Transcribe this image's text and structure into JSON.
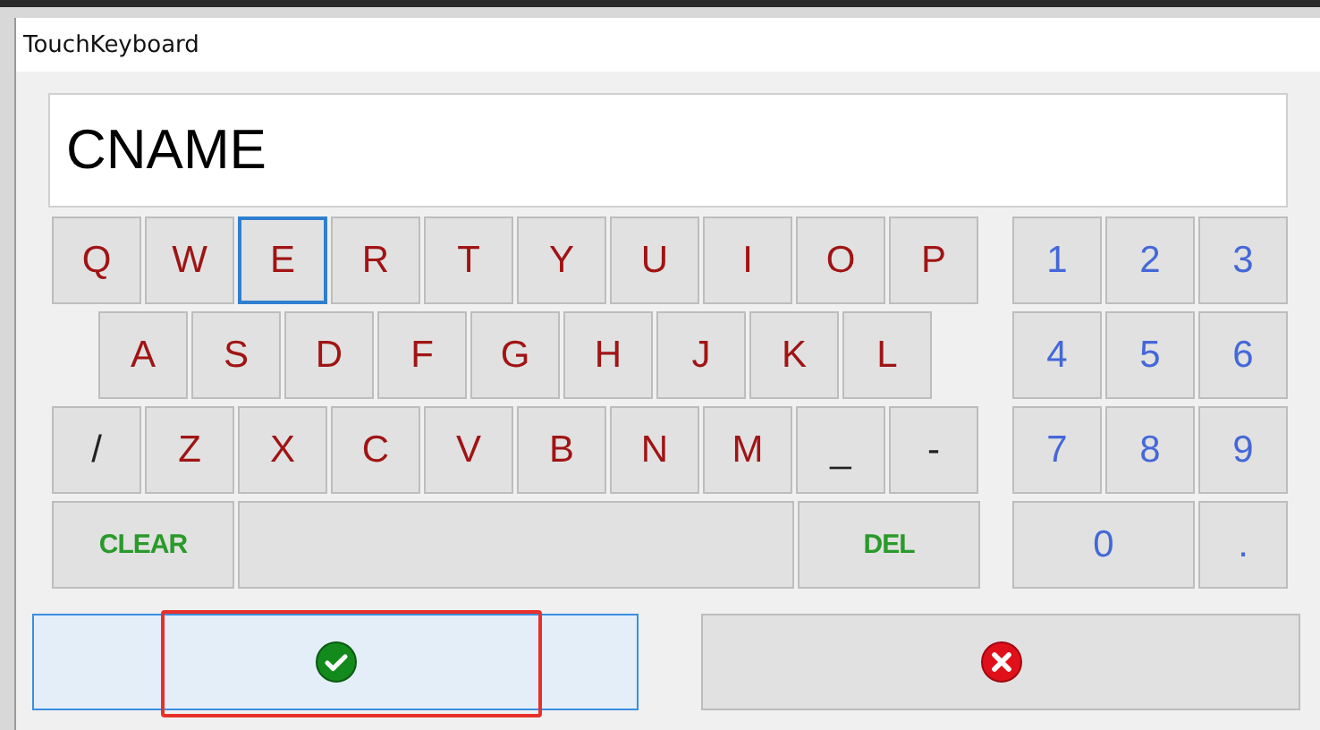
{
  "window": {
    "title": "TouchKeyboard"
  },
  "input": {
    "value": "CNAME"
  },
  "letter_rows": [
    [
      {
        "label": "Q",
        "kind": "letter",
        "focused": false
      },
      {
        "label": "W",
        "kind": "letter",
        "focused": false
      },
      {
        "label": "E",
        "kind": "letter",
        "focused": true
      },
      {
        "label": "R",
        "kind": "letter",
        "focused": false
      },
      {
        "label": "T",
        "kind": "letter",
        "focused": false
      },
      {
        "label": "Y",
        "kind": "letter",
        "focused": false
      },
      {
        "label": "U",
        "kind": "letter",
        "focused": false
      },
      {
        "label": "I",
        "kind": "letter",
        "focused": false
      },
      {
        "label": "O",
        "kind": "letter",
        "focused": false
      },
      {
        "label": "P",
        "kind": "letter",
        "focused": false
      }
    ],
    [
      {
        "label": "A",
        "kind": "letter",
        "focused": false
      },
      {
        "label": "S",
        "kind": "letter",
        "focused": false
      },
      {
        "label": "D",
        "kind": "letter",
        "focused": false
      },
      {
        "label": "F",
        "kind": "letter",
        "focused": false
      },
      {
        "label": "G",
        "kind": "letter",
        "focused": false
      },
      {
        "label": "H",
        "kind": "letter",
        "focused": false
      },
      {
        "label": "J",
        "kind": "letter",
        "focused": false
      },
      {
        "label": "K",
        "kind": "letter",
        "focused": false
      },
      {
        "label": "L",
        "kind": "letter",
        "focused": false
      }
    ],
    [
      {
        "label": "/",
        "kind": "symbol",
        "focused": false
      },
      {
        "label": "Z",
        "kind": "letter",
        "focused": false
      },
      {
        "label": "X",
        "kind": "letter",
        "focused": false
      },
      {
        "label": "C",
        "kind": "letter",
        "focused": false
      },
      {
        "label": "V",
        "kind": "letter",
        "focused": false
      },
      {
        "label": "B",
        "kind": "letter",
        "focused": false
      },
      {
        "label": "N",
        "kind": "letter",
        "focused": false
      },
      {
        "label": "M",
        "kind": "letter",
        "focused": false
      },
      {
        "label": "_",
        "kind": "symbol",
        "focused": false
      },
      {
        "label": "-",
        "kind": "symbol",
        "focused": false
      }
    ],
    [
      {
        "label": "CLEAR",
        "kind": "action",
        "focused": false
      },
      {
        "kind": "space",
        "focused": false
      },
      {
        "label": "DEL",
        "kind": "action",
        "focused": false
      }
    ]
  ],
  "numpad_rows": [
    [
      {
        "label": "1"
      },
      {
        "label": "2"
      },
      {
        "label": "3"
      }
    ],
    [
      {
        "label": "4"
      },
      {
        "label": "5"
      },
      {
        "label": "6"
      }
    ],
    [
      {
        "label": "7"
      },
      {
        "label": "8"
      },
      {
        "label": "9"
      }
    ],
    [
      {
        "label": "0"
      },
      {
        "label": "."
      }
    ]
  ],
  "ok_button": {
    "highlighted": true
  }
}
